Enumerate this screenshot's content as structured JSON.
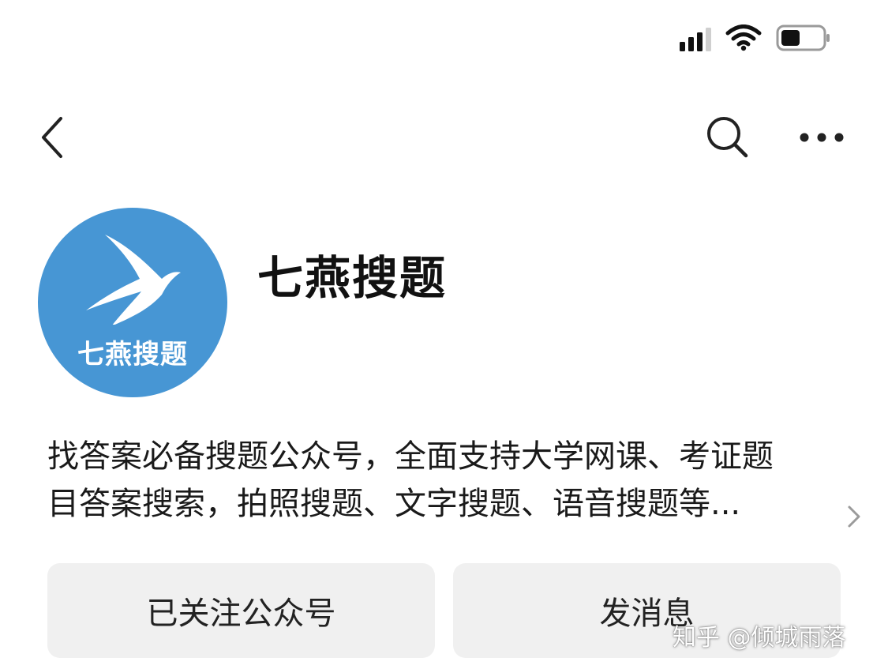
{
  "status_bar": {
    "signal_icon": "cellular-signal-icon",
    "wifi_icon": "wifi-icon",
    "battery_icon": "battery-icon",
    "battery_level": 0.45
  },
  "nav": {
    "back_icon": "chevron-left-icon",
    "search_icon": "search-icon",
    "more_icon": "more-horizontal-icon"
  },
  "profile": {
    "avatar_text": "七燕搜题",
    "avatar_color": "#4796d4",
    "name": "七燕搜题",
    "description_lines": [
      "找答案必备搜题公众号，全面支持大学网课、考证题",
      "目答案搜索，拍照搜题、文字搜题、语音搜题等..."
    ]
  },
  "actions": {
    "follow_label": "已关注公众号",
    "message_label": "发消息"
  },
  "watermark": "知乎 @倾城雨落"
}
